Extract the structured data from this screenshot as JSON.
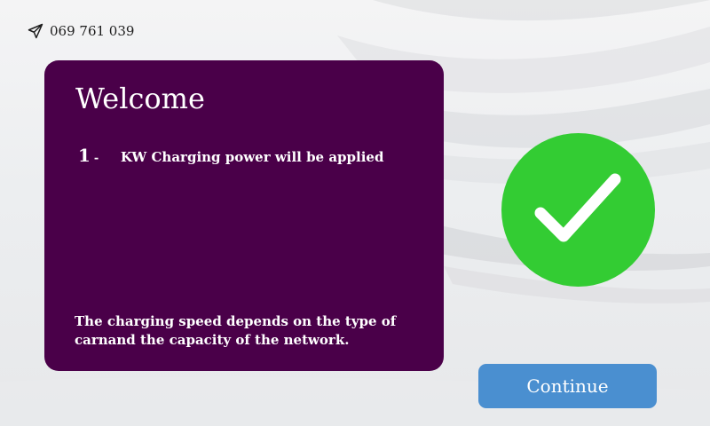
{
  "header": {
    "phone_icon": "send-icon",
    "phone_number": "069 761 039"
  },
  "card": {
    "title": "Welcome",
    "item": {
      "number": "1",
      "separator": "-",
      "text": "KW Charging power will be applied"
    },
    "note": "The charging speed depends on the type of carnand the capacity of the network."
  },
  "status": {
    "icon": "checkmark-icon",
    "color": "#33cc33"
  },
  "actions": {
    "continue_label": "Continue",
    "button_color": "#4a8fd0"
  },
  "theme": {
    "card_color": "#4a0049"
  }
}
